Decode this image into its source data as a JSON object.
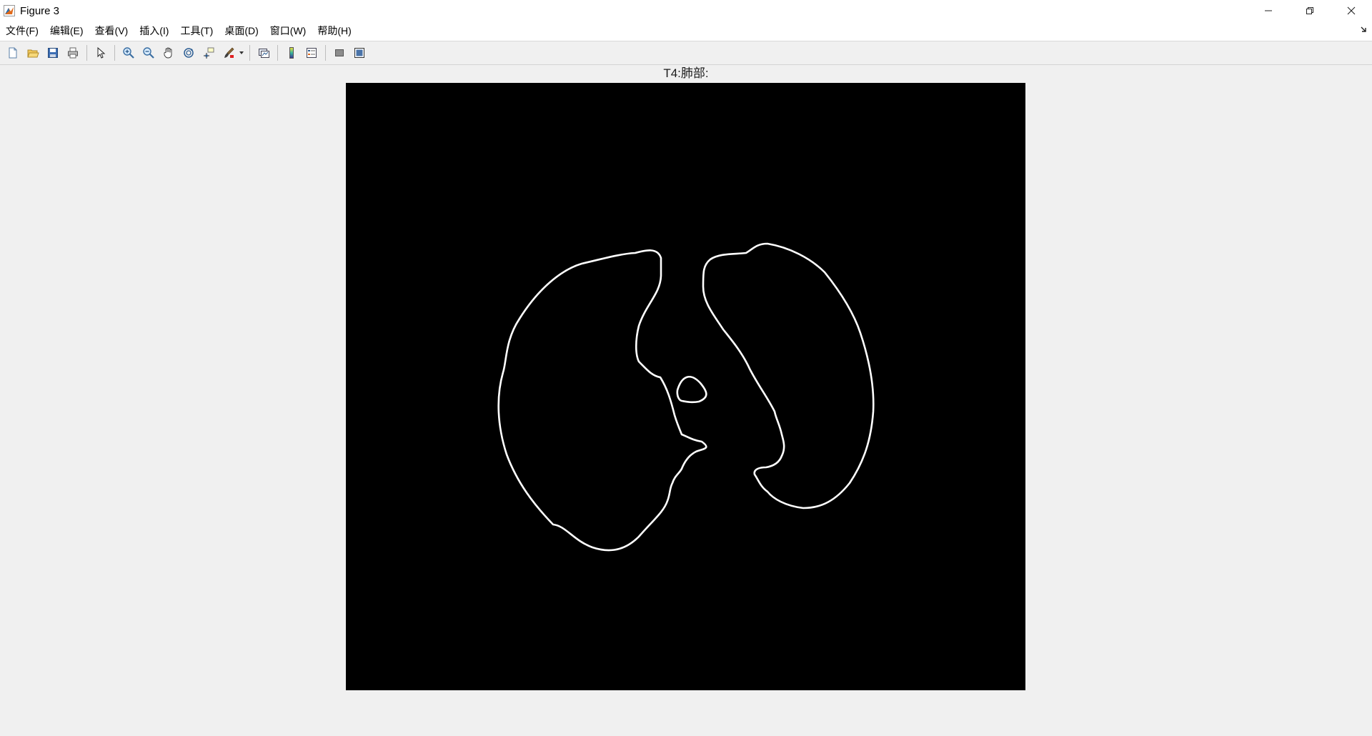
{
  "window": {
    "title": "Figure 3"
  },
  "menubar": {
    "items": [
      {
        "label": "文件(F)"
      },
      {
        "label": "编辑(E)"
      },
      {
        "label": "查看(V)"
      },
      {
        "label": "插入(I)"
      },
      {
        "label": "工具(T)"
      },
      {
        "label": "桌面(D)"
      },
      {
        "label": "窗口(W)"
      },
      {
        "label": "帮助(H)"
      }
    ]
  },
  "toolbar": {
    "icons": [
      "new-figure-icon",
      "open-file-icon",
      "save-icon",
      "print-icon",
      "select-arrow-icon",
      "zoom-in-icon",
      "zoom-out-icon",
      "pan-hand-icon",
      "rotate-3d-icon",
      "data-cursor-icon",
      "brush-icon",
      "link-plot-icon",
      "colorbar-icon",
      "legend-icon",
      "hide-plot-tools-icon",
      "show-plot-tools-icon"
    ]
  },
  "figure": {
    "axes_title": "T4:肺部:",
    "image_background": "#000000",
    "contour_color": "#ffffff"
  },
  "colors": {
    "window_bg": "#f0f0f0",
    "titlebar_bg": "#ffffff"
  }
}
